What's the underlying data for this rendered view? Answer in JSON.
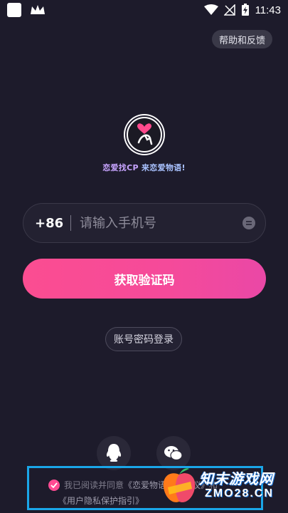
{
  "status_bar": {
    "time": "11:43",
    "icons": [
      "app-square-icon",
      "crown-icon",
      "wifi-icon",
      "no-signal-icon",
      "battery-charging-icon"
    ]
  },
  "header": {
    "help_label": "帮助和反馈"
  },
  "brand": {
    "slogan_part1": "恋爱找CP ",
    "slogan_part2": "来恋爱物语!",
    "colors": {
      "slogan_gradient_start": "#c7a4ff",
      "slogan_gradient_end": "#8fd0ff"
    }
  },
  "login": {
    "country_code": "+86",
    "phone_placeholder": "请输入手机号",
    "get_code_label": "获取验证码",
    "password_login_label": "账号密码登录"
  },
  "social": {
    "icons": [
      "qq-icon",
      "wechat-icon"
    ]
  },
  "agreement": {
    "prefix": "我已阅读并同意",
    "user_agreement": "《恋爱物语用户协议》",
    "conjunction": "和",
    "privacy": "《用户隐私保护指引》"
  },
  "watermark": {
    "title": "知末游戏网",
    "domain": "ZMO28.CN"
  },
  "colors": {
    "background": "#1d1b2b",
    "accent": "#fb4d91",
    "highlight_box": "#1aa6e8"
  }
}
